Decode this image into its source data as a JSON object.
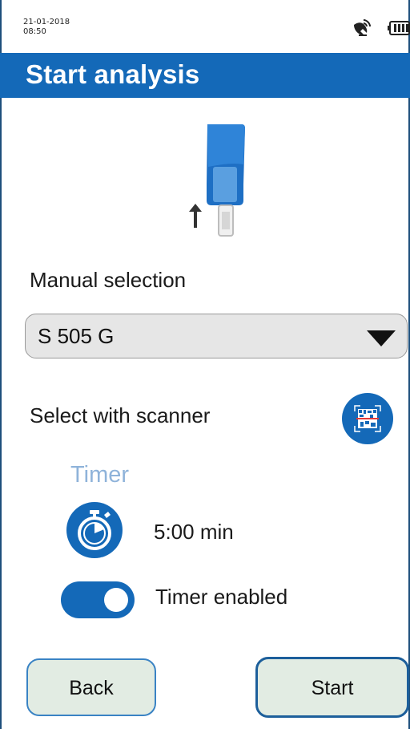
{
  "status_bar": {
    "date": "21-01-2018",
    "time": "08:50",
    "signal_icon": "satellite-signal-icon",
    "battery_icon": "battery-icon"
  },
  "header": {
    "title": "Start analysis"
  },
  "illustration": {
    "icon": "sensor-device-insert-icon"
  },
  "manual_selection": {
    "label": "Manual selection",
    "selected_value": "S 505 G"
  },
  "scanner": {
    "label": "Select with scanner",
    "icon": "barcode-scanner-icon"
  },
  "timer": {
    "section_label": "Timer",
    "duration": "5:00 min",
    "icon": "stopwatch-icon",
    "toggle_label": "Timer enabled",
    "enabled": true
  },
  "buttons": {
    "back_label": "Back",
    "start_label": "Start"
  },
  "colors": {
    "primary": "#1469b8",
    "timer_label": "#8fb3da",
    "button_fill": "#e2ece3"
  }
}
